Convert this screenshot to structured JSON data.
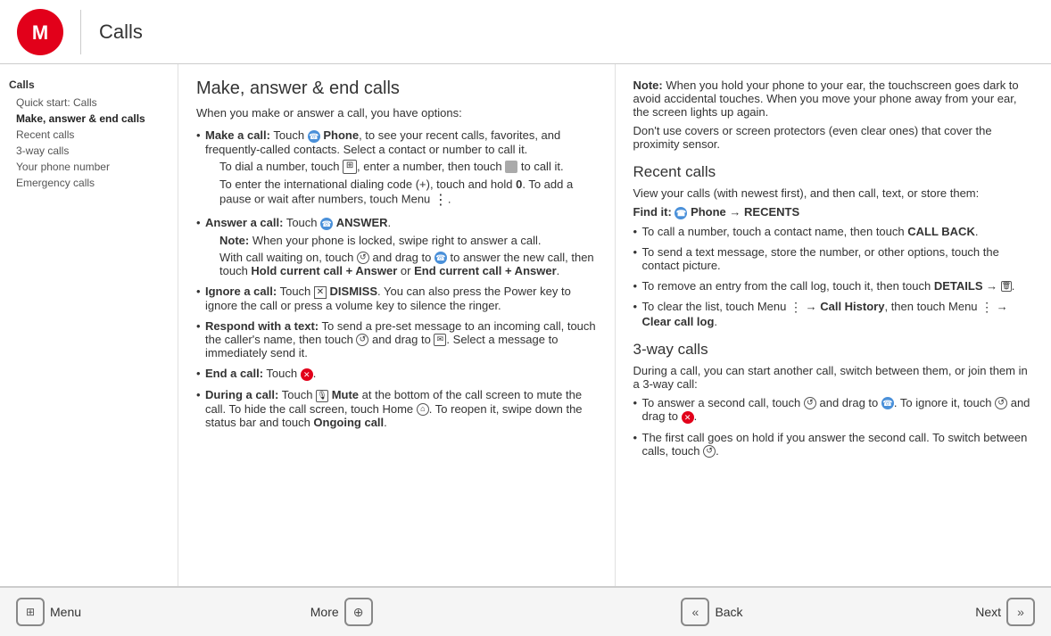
{
  "header": {
    "title": "Calls"
  },
  "sidebar": {
    "section": "Calls",
    "items": [
      {
        "label": "Quick start: Calls",
        "active": false
      },
      {
        "label": "Make, answer & end calls",
        "active": true
      },
      {
        "label": "Recent calls",
        "active": false
      },
      {
        "label": "3-way calls",
        "active": false
      },
      {
        "label": "Your phone number",
        "active": false
      },
      {
        "label": "Emergency calls",
        "active": false
      }
    ]
  },
  "left_column": {
    "heading": "Make, answer & end calls",
    "intro": "When you make or answer a call, you have options:",
    "bullets": [
      {
        "label": "Make a call:",
        "text_parts": [
          "Touch ",
          " Phone",
          ", to see your recent calls, favorites, and frequently-called contacts. Select a contact or number to call it."
        ],
        "has_phone_icon": true,
        "extra": [
          "To dial a number, touch  , enter a number, then touch   to call it.",
          "To enter the international dialing code (+), touch and hold 0. To add a pause or wait after numbers, touch Menu  ."
        ]
      },
      {
        "label": "Answer a call:",
        "text": "Touch  ANSWER.",
        "note": "Note: When your phone is locked, swipe right to answer a call.",
        "extra": "With call waiting on, touch   and drag to   to answer the new call, then touch Hold current call + Answer or End current call + Answer."
      },
      {
        "label": "Ignore a call:",
        "text": "Touch  DISMISS. You can also press the Power key to ignore the call or press a volume key to silence the ringer."
      },
      {
        "label": "Respond with a text:",
        "text": "To send a pre-set message to an incoming call, touch the caller's name, then touch   and drag to  . Select a message to immediately send it."
      },
      {
        "label": "End a call:",
        "text": "Touch  ."
      },
      {
        "label": "During a call:",
        "text_parts": [
          "Touch  ",
          " Mute",
          " at the bottom of the call screen to mute the call. To hide the call screen, touch Home  . To reopen it, swipe down the status bar and touch ",
          "Ongoing call",
          "."
        ]
      }
    ]
  },
  "right_column": {
    "note": {
      "label": "Note:",
      "text": " When you hold your phone to your ear, the touchscreen goes dark to avoid accidental touches. When you move your phone away from your ear, the screen lights up again."
    },
    "note2": "Don't use covers or screen protectors (even clear ones) that cover the proximity sensor.",
    "recent_calls": {
      "heading": "Recent calls",
      "intro": "View your calls (with newest first), and then call, text, or store them:",
      "find_it": "Find it:  Phone → RECENTS",
      "bullets": [
        "To call a number, touch a contact name, then touch CALL BACK.",
        "To send a text message, store the number, or other options, touch the contact picture.",
        "To remove an entry from the call log, touch it, then touch DETAILS →  .",
        "To clear the list, touch Menu   → Call History, then touch Menu   → Clear call log."
      ]
    },
    "three_way_calls": {
      "heading": "3-way calls",
      "intro": "During a call, you can start another call, switch between them, or join them in a 3-way call:",
      "bullets": [
        "To answer a second call, touch   and drag to  . To ignore it, touch   and drag to  .",
        "The first call goes on hold if you answer the second call. To switch between calls, touch  ."
      ]
    }
  },
  "footer": {
    "menu_label": "Menu",
    "back_label": "Back",
    "more_label": "More",
    "next_label": "Next"
  }
}
